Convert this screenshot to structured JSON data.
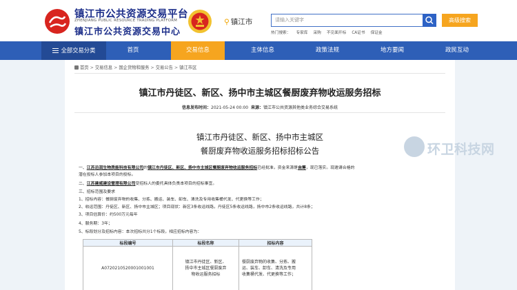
{
  "header": {
    "logo_title": "镇江市公共资源交易平台",
    "logo_en": "ZHENJIANG PUBLIC RESOURCE TRADING PLATFORM",
    "logo_sub": "镇江市公共资源交易中心",
    "city": "镇江市",
    "search_placeholder": "请输入关键字",
    "adv_search": "高级搜索",
    "hotwords": [
      "热门搜索：",
      "专家库",
      "采购",
      "不见面开标",
      "CA证书",
      "保证金"
    ]
  },
  "nav": {
    "all": "全部交易分类",
    "items": [
      "首页",
      "交易信息",
      "主体信息",
      "政策法规",
      "地方要闻",
      "政民互动"
    ],
    "active_index": 1
  },
  "breadcrumb": [
    "首页",
    "交易信息",
    "国企货物和服务",
    "交易公告",
    "镇江市区"
  ],
  "article": {
    "title": "镇江市丹徒区、新区、扬中市主城区餐厨废弃物收运服务招标",
    "info_time_label": "信息发布时间：",
    "info_time": "2021-05-24 00:00",
    "info_source_label": "来源：",
    "info_source": "镇江市公共资源其他类业务综合交易系统",
    "doc_title_1": "镇江市丹徒区、新区、扬中市主城区",
    "doc_title_2": "餐厨废弃物收运服务招标招标公告",
    "p1_a": "一、",
    "p1_owner": "江苏迅润生物质能科技有限公司",
    "p1_b": "的",
    "p1_project": "镇江市丹徒区、新区、扬中市主城区餐厨废弃物收运服务招标",
    "p1_c": "已经批准，资金来源是",
    "p1_fund": "自筹",
    "p1_d": "，现已落实。现邀请合格的",
    "p1_cont": "潜在投标人参加本项目的投标。",
    "p2_a": "二、",
    "p2_agent": "江苏建威建设管理有限公司",
    "p2_b": "受招标人的委托具体负责本项目的招标事宜。",
    "p3": "三、招标范围及要求",
    "p3_1": "1、招标内容：餐厨废弃物的收集、分拣、搬运、装车、卸车、清洗及专用收集桶代发、代更换等工作；",
    "p3_2": "2、收运范围：丹徒区、新区、扬中市主城区；项目现状：新区3条收运线路，丹徒区5条收运线路，扬中市2条收运线路，共计8条；",
    "p3_3": "3、项目估算价：约500万元每年",
    "p3_4": "4、服务期：3年；",
    "p3_5": "5、标段划分及招标内容：本次招标共分1个标段，相应招标内容为："
  },
  "table": {
    "headers": [
      "标段编号",
      "标段名称",
      "招标内容"
    ],
    "rows": [
      {
        "code": "A072021052000100100​1",
        "name_lines": [
          "镇江市丹徒区、新区、",
          "扬中市主城区餐厨废弃",
          "物收运服务招标"
        ],
        "content_lines": [
          "餐厨废弃物的收集、分拣、搬",
          "运、装车、卸车、清洗及专用",
          "收集桶代发、代更换等工作；"
        ]
      }
    ]
  },
  "watermark": "环卫科技网",
  "colors": {
    "nav": "#2e5fb7",
    "accent": "#f6a51f",
    "brand": "#1d2f8a"
  }
}
